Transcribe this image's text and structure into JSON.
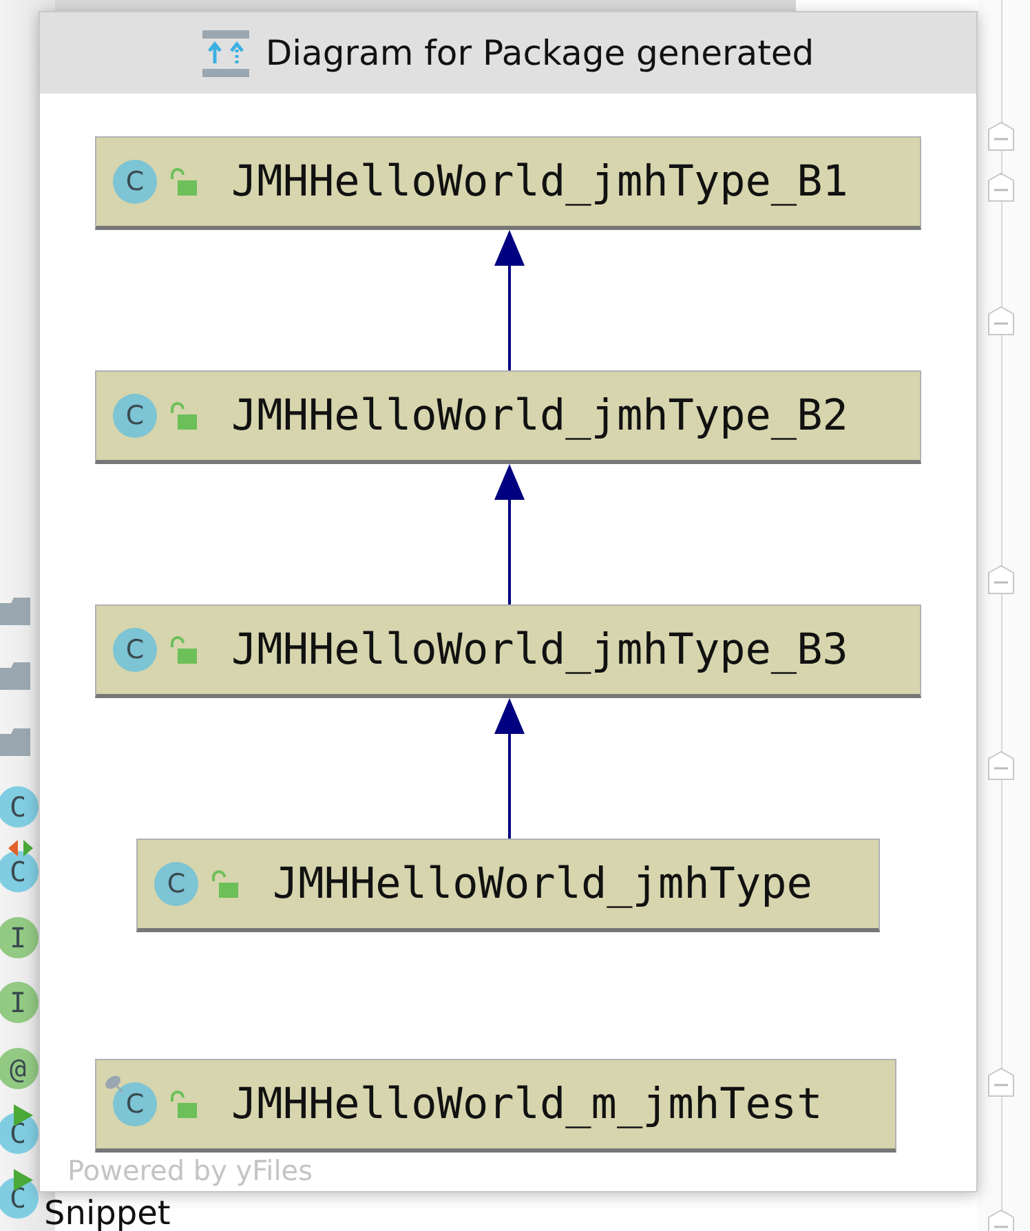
{
  "window": {
    "title": "Diagram for Package generated"
  },
  "nodes": [
    {
      "label": "JMHHelloWorld_jmhType_B1",
      "icon_letter": "C",
      "kind": "class",
      "extends_previous": false
    },
    {
      "label": "JMHHelloWorld_jmhType_B2",
      "icon_letter": "C",
      "kind": "class",
      "extends_previous": true
    },
    {
      "label": "JMHHelloWorld_jmhType_B3",
      "icon_letter": "C",
      "kind": "class",
      "extends_previous": true
    },
    {
      "label": "JMHHelloWorld_jmhType",
      "icon_letter": "C",
      "kind": "class",
      "extends_previous": true
    },
    {
      "label": "JMHHelloWorld_m_jmhTest",
      "icon_letter": "C",
      "kind": "test",
      "extends_previous": false
    }
  ],
  "credit": "Powered by yFiles",
  "gutter_icons": [
    {
      "kind": "folder"
    },
    {
      "kind": "folder"
    },
    {
      "kind": "folder"
    },
    {
      "kind": "class",
      "letter": "C"
    },
    {
      "kind": "class-override",
      "letter": "C"
    },
    {
      "kind": "interface",
      "letter": "I"
    },
    {
      "kind": "interface",
      "letter": "I"
    },
    {
      "kind": "annotation",
      "letter": "@"
    },
    {
      "kind": "class-run",
      "letter": "C"
    },
    {
      "kind": "class-run",
      "letter": "C"
    }
  ],
  "editor_text": "Snippet"
}
